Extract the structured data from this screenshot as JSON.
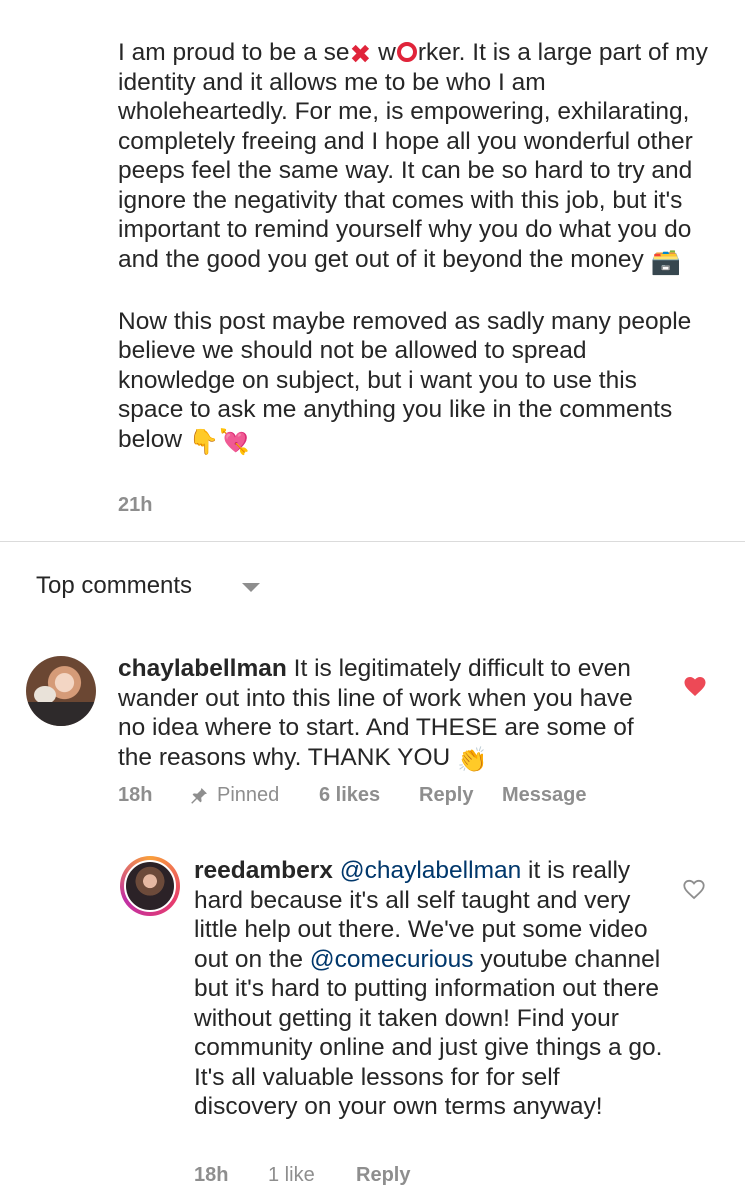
{
  "post": {
    "caption_line1_before_x": "I am proud to be a se",
    "caption_line1_after_x": " w",
    "caption_line1_after_o": "rker. It is a large part of my identity and it allows me to be who I am wholeheartedly. For me, is empowering, exhilarating, completely freeing and I hope all you wonderful other peeps feel the same way. It can be so hard to try and ignore the negativity that comes with this job, but it's important to remind yourself why you do what you do and the good you get out of it beyond the money",
    "caption_para2": "Now this post maybe removed as sadly many people believe we should not be allowed to spread knowledge on subject, but i want you to use this space to ask me anything you like in the comments below",
    "emoji_money_box": "🗃️",
    "emoji_point_down": "👇",
    "emoji_heart_arrow": "💘",
    "timestamp": "21h"
  },
  "comments_header": {
    "label": "Top comments"
  },
  "comments": [
    {
      "username": "chaylabellman",
      "text": " It is legitimately difficult to even wander out into this line of work when you have no idea where to start. And THESE are some of the reasons why. THANK YOU ",
      "emoji": "👏",
      "time": "18h",
      "pinned_label": "Pinned",
      "likes": "6 likes",
      "reply_label": "Reply",
      "message_label": "Message",
      "liked": true
    },
    {
      "username": "reedamberx",
      "mention1": "@chaylabellman",
      "text_a": " it is really hard because it's all self taught and very little help out there. We've put some video out on the ",
      "mention2": "@comecurious",
      "text_b": " youtube channel but it's hard to putting information out there without getting it taken down! Find your community online and just give things a go. It's all valuable lessons for for self discovery on your own terms anyway!",
      "time": "18h",
      "likes": "1 like",
      "reply_label": "Reply",
      "liked": false
    }
  ],
  "colors": {
    "text": "#262626",
    "muted": "#8e8e8e",
    "like_red": "#ed4956",
    "mention_blue": "#00376b",
    "censor_red": "#e0243a"
  }
}
